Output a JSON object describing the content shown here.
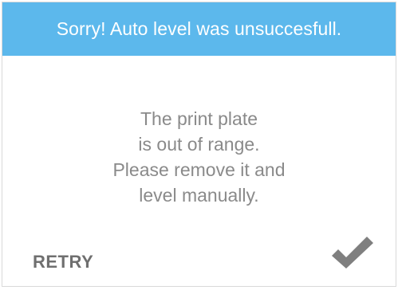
{
  "header": {
    "title": "Sorry! Auto level was unsuccesfull."
  },
  "message": {
    "lines": [
      "The print plate",
      "is out of range.",
      "Please remove it and",
      "level manually."
    ]
  },
  "actions": {
    "retry_label": "RETRY",
    "confirm_icon": "checkmark-icon"
  },
  "colors": {
    "header_bg": "#5cb8ec",
    "header_text": "#ffffff",
    "message_text": "#8a8a8a",
    "retry_text": "#6f6f6f",
    "check_icon": "#7f7f7f"
  }
}
